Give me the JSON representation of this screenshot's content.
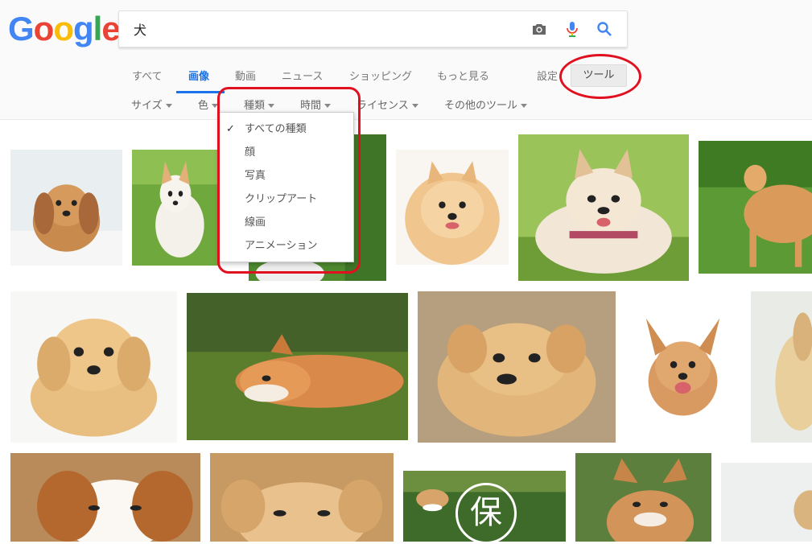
{
  "logo": {
    "letters": [
      "G",
      "o",
      "o",
      "g",
      "l",
      "e"
    ],
    "colors": [
      "#4285F4",
      "#EA4335",
      "#FBBC05",
      "#4285F4",
      "#34A853",
      "#EA4335"
    ]
  },
  "search": {
    "query": "犬"
  },
  "tabs": [
    {
      "label": "すべて"
    },
    {
      "label": "画像"
    },
    {
      "label": "動画"
    },
    {
      "label": "ニュース"
    },
    {
      "label": "ショッピング"
    },
    {
      "label": "もっと見る"
    }
  ],
  "settings_label": "設定",
  "tools_label": "ツール",
  "filters": [
    {
      "label": "サイズ"
    },
    {
      "label": "色"
    },
    {
      "label": "種類"
    },
    {
      "label": "時間"
    },
    {
      "label": "ライセンス"
    },
    {
      "label": "その他のツール"
    }
  ],
  "type_dropdown": {
    "items": [
      {
        "label": "すべての種類",
        "checked": true
      },
      {
        "label": "顔"
      },
      {
        "label": "写真"
      },
      {
        "label": "クリップアート"
      },
      {
        "label": "線画"
      },
      {
        "label": "アニメーション"
      }
    ]
  },
  "thumbnail_badge": "保",
  "colors": {
    "accent": "#1a73e8",
    "annotation": "#e01020"
  }
}
